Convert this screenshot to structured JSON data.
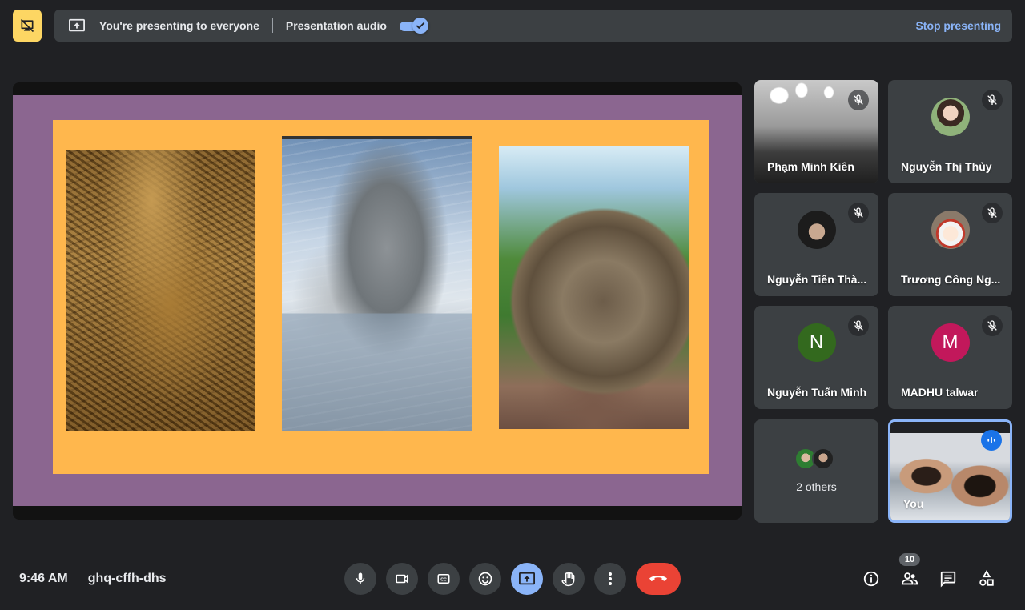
{
  "banner": {
    "message": "You're presenting to everyone",
    "audio_label": "Presentation audio",
    "audio_enabled": true,
    "stop_label": "Stop presenting"
  },
  "participants": [
    {
      "name": "Phạm Minh Kiên",
      "muted": true,
      "type": "video"
    },
    {
      "name": "Nguyễn Thị Thủy",
      "muted": true,
      "type": "photo"
    },
    {
      "name": "Nguyễn Tiến Thà...",
      "muted": true,
      "type": "photo"
    },
    {
      "name": "Trương Công Ng...",
      "muted": true,
      "type": "photo"
    },
    {
      "name": "Nguyễn Tuấn Minh",
      "muted": true,
      "type": "initial",
      "initial": "N",
      "color": "#33691e"
    },
    {
      "name": "MADHU talwar",
      "muted": true,
      "type": "initial",
      "initial": "M",
      "color": "#c2185b"
    }
  ],
  "others": {
    "label": "2 others"
  },
  "self": {
    "name": "You",
    "speaking": true
  },
  "meeting": {
    "time": "9:46 AM",
    "code": "ghq-cffh-dhs"
  },
  "people_count": "10",
  "colors": {
    "accent": "#8ab4f8",
    "end_call": "#ea4335",
    "banner_icon": "#fdd663"
  }
}
